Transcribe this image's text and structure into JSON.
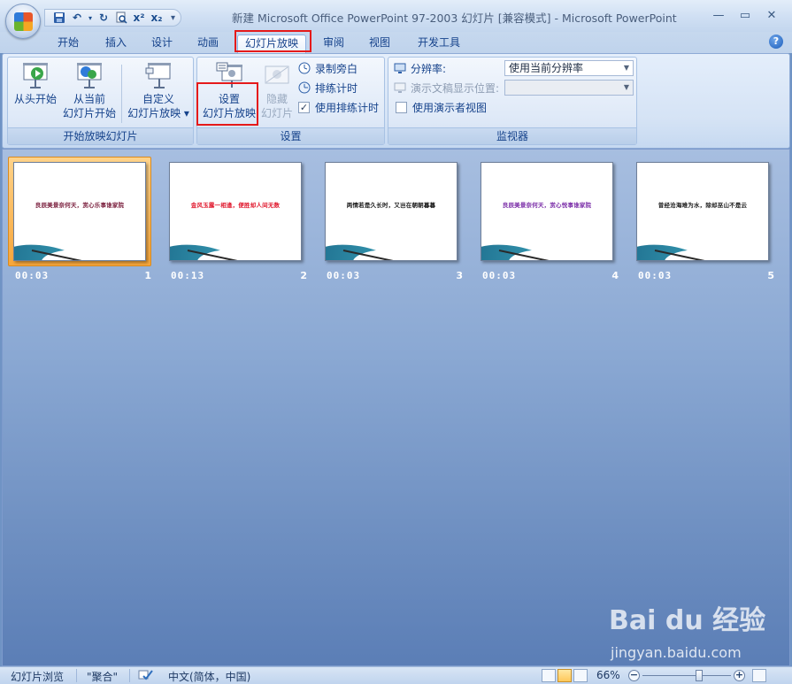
{
  "window": {
    "title": "新建 Microsoft Office PowerPoint 97-2003 幻灯片 [兼容模式] - Microsoft PowerPoint",
    "minimize_icon": "minimize-icon",
    "maximize_icon": "maximize-icon",
    "close_icon": "close-icon"
  },
  "quick_access": {
    "items": [
      "save-icon",
      "undo-icon",
      "redo-icon",
      "print-preview-icon",
      "superscript-icon",
      "subscript-icon",
      "customize-qat-icon"
    ]
  },
  "tabs": {
    "items": [
      {
        "label": "开始"
      },
      {
        "label": "插入"
      },
      {
        "label": "设计"
      },
      {
        "label": "动画"
      },
      {
        "label": "幻灯片放映"
      },
      {
        "label": "审阅"
      },
      {
        "label": "视图"
      },
      {
        "label": "开发工具"
      }
    ],
    "active": "幻灯片放映"
  },
  "ribbon": {
    "start_group": {
      "label": "开始放映幻灯片",
      "from_beginning": "从头开始",
      "from_current_line1": "从当前",
      "from_current_line2": "幻灯片开始",
      "custom_line1": "自定义",
      "custom_line2": "幻灯片放映 ▾"
    },
    "setup_group": {
      "label": "设置",
      "setup_line1": "设置",
      "setup_line2": "幻灯片放映",
      "hide_line1": "隐藏",
      "hide_line2": "幻灯片",
      "record_narration": "录制旁白",
      "rehearse_timings": "排练计时",
      "use_rehearsed_timings": "使用排练计时",
      "use_rehearsed_checked": "✓"
    },
    "monitor_group": {
      "label": "监视器",
      "resolution_label": "分辨率:",
      "resolution_value": "使用当前分辨率",
      "show_on_label": "演示文稿显示位置:",
      "show_on_value": "",
      "presenter_view": "使用演示者视图"
    }
  },
  "slides": [
    {
      "number": "1",
      "time": "00:03",
      "text": "良辰美景奈何天，赏心乐事谁家院",
      "color": "#7a1f3d",
      "selected": true
    },
    {
      "number": "2",
      "time": "00:13",
      "text": "金风玉露一相逢，便胜却人间无数",
      "color": "#e0182d",
      "selected": false
    },
    {
      "number": "3",
      "time": "00:03",
      "text": "两情若是久长时，又岂在朝朝暮暮",
      "color": "#1a1a1a",
      "selected": false
    },
    {
      "number": "4",
      "time": "00:03",
      "text": "良辰美景奈何天，赏心悦事谁家院",
      "color": "#7b2ea8",
      "selected": false
    },
    {
      "number": "5",
      "time": "00:03",
      "text": "曾经沧海难为水，除却巫山不是云",
      "color": "#1a1a1a",
      "selected": false
    }
  ],
  "watermark": {
    "logo": "Bai du 经验",
    "url": "jingyan.baidu.com"
  },
  "statusbar": {
    "view_name": "幻灯片浏览",
    "theme": "\"聚合\"",
    "language": "中文(简体，中国)",
    "zoom": "66%",
    "zoom_fraction": 0.66
  },
  "colors": {
    "highlight_red": "#e51a1a",
    "selected_slide": "#f7a63a",
    "workspace": "#7895c6"
  }
}
